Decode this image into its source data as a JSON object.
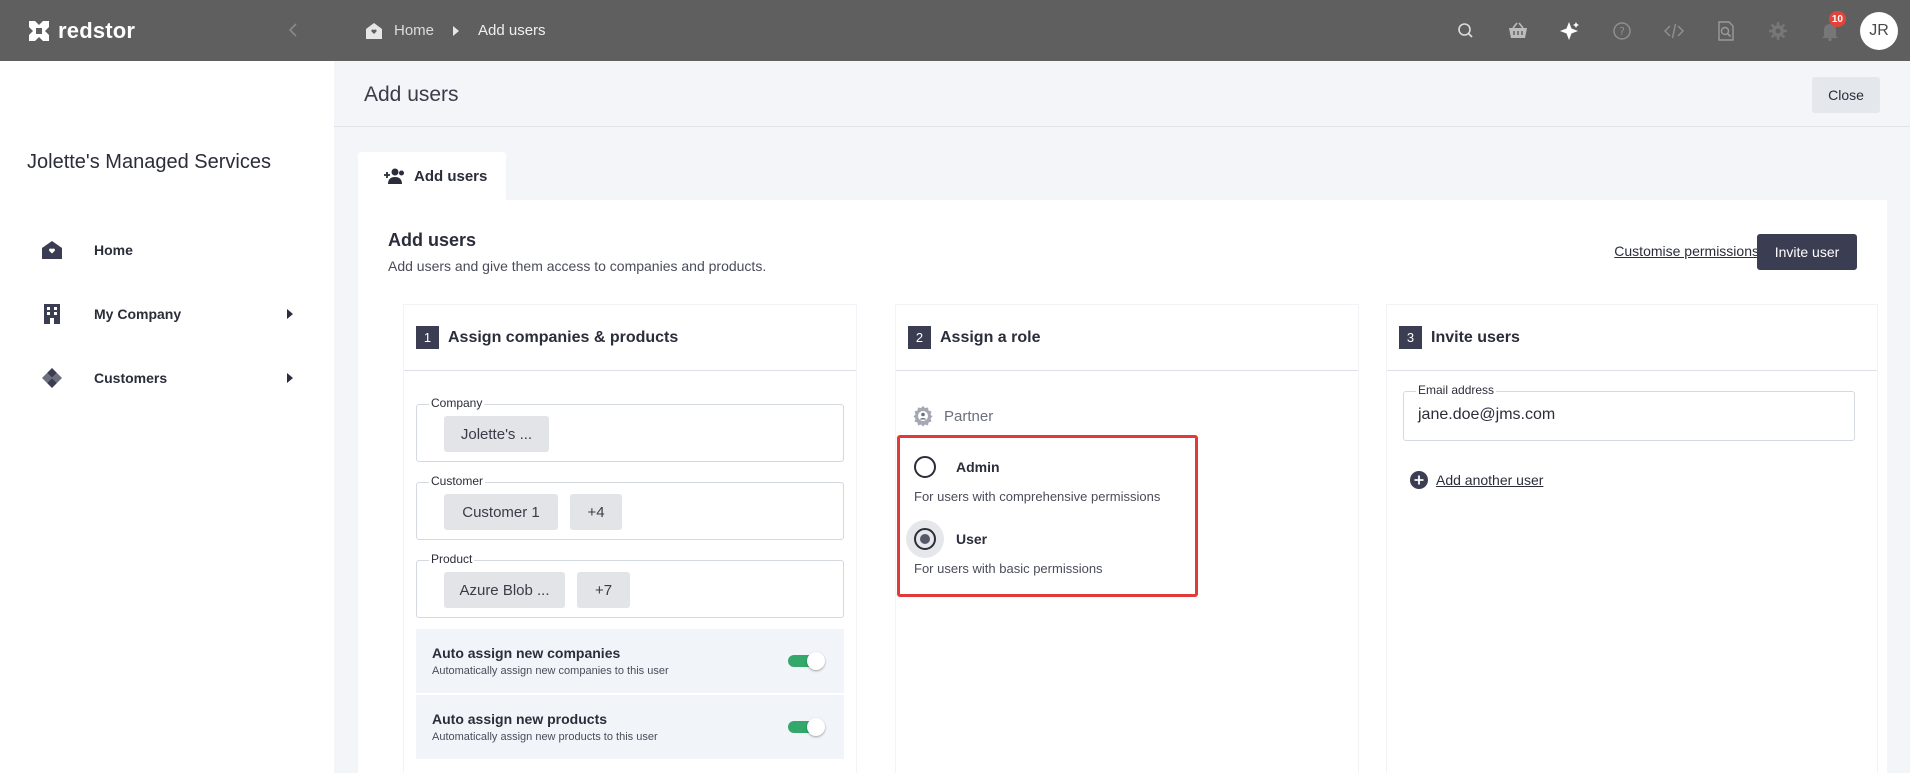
{
  "brand": {
    "name": "redstor"
  },
  "breadcrumb": {
    "home": "Home",
    "current": "Add users"
  },
  "topbar": {
    "notification_count": "10",
    "avatar_initials": "JR"
  },
  "sidebar": {
    "org_name": "Jolette's Managed Services",
    "items": [
      {
        "label": "Home"
      },
      {
        "label": "My Company"
      },
      {
        "label": "Customers"
      }
    ]
  },
  "page": {
    "title": "Add users",
    "close_label": "Close",
    "tab_label": "Add users"
  },
  "card": {
    "title": "Add users",
    "subtitle": "Add users and give them access to companies and products.",
    "customise_label": "Customise permissions",
    "invite_label": "Invite user"
  },
  "step1": {
    "num": "1",
    "title": "Assign companies & products",
    "company": {
      "label": "Company",
      "chips": [
        "Jolette's ..."
      ]
    },
    "customer": {
      "label": "Customer",
      "chips": [
        "Customer 1",
        "+4"
      ]
    },
    "product": {
      "label": "Product",
      "chips": [
        "Azure Blob ...",
        "+7"
      ]
    },
    "toggles": [
      {
        "title": "Auto assign new companies",
        "subtitle": "Automatically assign new companies to this user",
        "on": true
      },
      {
        "title": "Auto assign new products",
        "subtitle": "Automatically assign new products to this user",
        "on": true
      }
    ]
  },
  "step2": {
    "num": "2",
    "title": "Assign a role",
    "group_label": "Partner",
    "roles": [
      {
        "label": "Admin",
        "description": "For users with comprehensive permissions",
        "selected": false
      },
      {
        "label": "User",
        "description": "For users with basic permissions",
        "selected": true
      }
    ]
  },
  "step3": {
    "num": "3",
    "title": "Invite users",
    "email_label": "Email address",
    "email_value": "jane.doe@jms.com",
    "add_another_label": "Add another user"
  },
  "colors": {
    "topbar": "#5f5f60",
    "primary_button": "#3b3e52",
    "toggle_on": "#34a86b",
    "highlight": "#e03b3b",
    "badge": "#e0443a"
  }
}
